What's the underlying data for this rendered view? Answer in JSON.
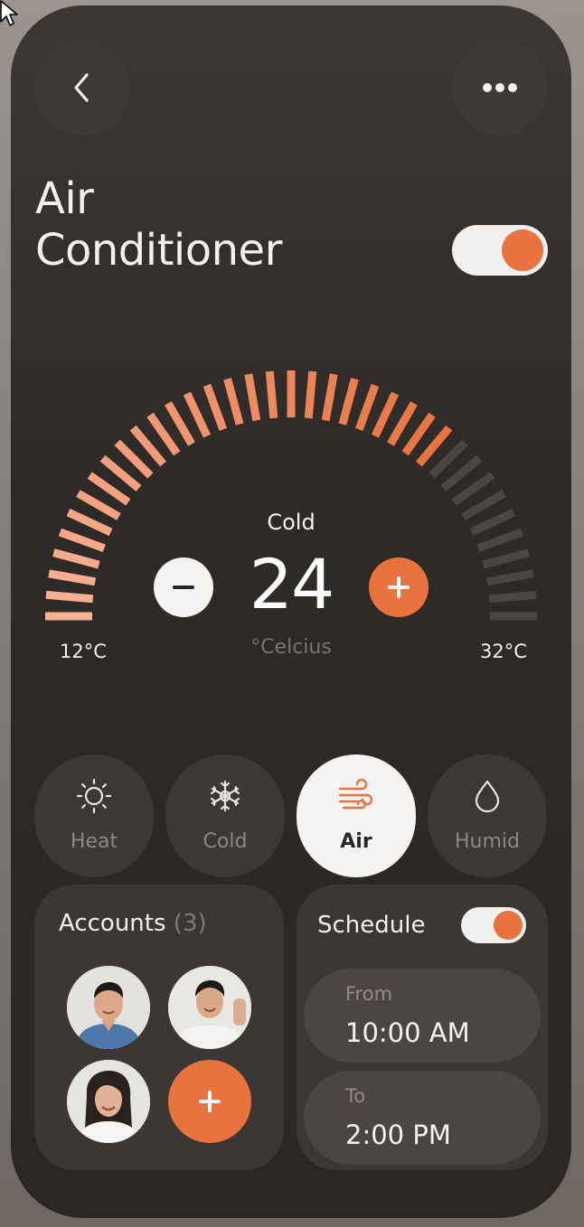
{
  "header": {
    "back_icon": "chevron-left-icon",
    "more_icon": "more-horizontal-icon"
  },
  "title": {
    "line1": "Air",
    "line2": "Conditioner"
  },
  "power_toggle": {
    "on": true
  },
  "thermostat": {
    "mode_label": "Cold",
    "temperature": "24",
    "unit": "°Celcius",
    "min_label": "12°C",
    "max_label": "32°C",
    "level_fraction": 0.73,
    "accent": "#e8733f"
  },
  "modes": [
    {
      "label": "Heat",
      "icon": "sun-icon",
      "active": false
    },
    {
      "label": "Cold",
      "icon": "snowflake-icon",
      "active": false
    },
    {
      "label": "Air",
      "icon": "wind-icon",
      "active": true
    },
    {
      "label": "Humid",
      "icon": "droplet-icon",
      "active": false
    }
  ],
  "accounts": {
    "label": "Accounts",
    "count": "(3)"
  },
  "schedule": {
    "label": "Schedule",
    "enabled": true,
    "from_label": "From",
    "from_value": "10:00 AM",
    "to_label": "To",
    "to_value": "2:00 PM"
  }
}
